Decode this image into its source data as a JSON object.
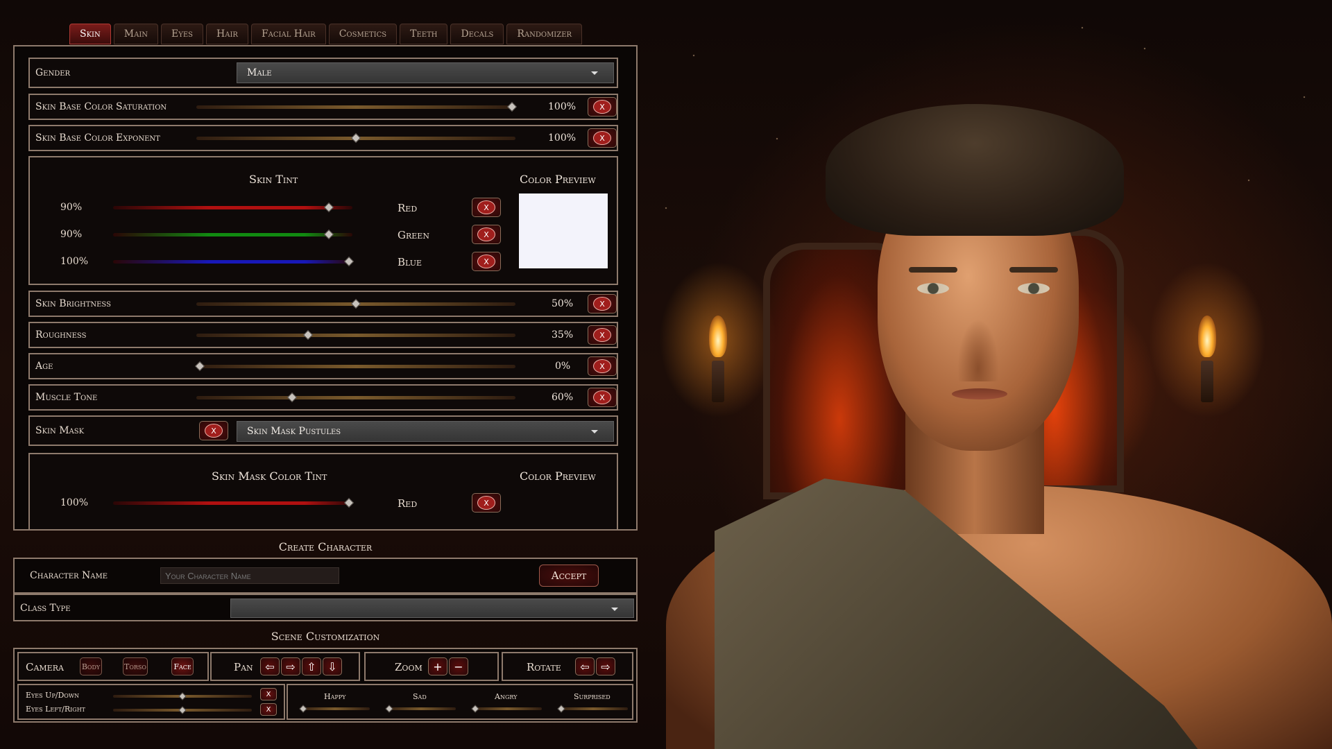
{
  "tabs": [
    {
      "label": "Skin",
      "active": true
    },
    {
      "label": "Main"
    },
    {
      "label": "Eyes"
    },
    {
      "label": "Hair"
    },
    {
      "label": "Facial Hair"
    },
    {
      "label": "Cosmetics"
    },
    {
      "label": "Teeth"
    },
    {
      "label": "Decals"
    },
    {
      "label": "Randomizer"
    }
  ],
  "gender": {
    "label": "Gender",
    "value": "Male"
  },
  "sliders_top": [
    {
      "label": "Skin Base Color Saturation",
      "value": "100%",
      "level": 1.0
    },
    {
      "label": "Skin Base Color Exponent",
      "value": "100%",
      "level": 0.5
    }
  ],
  "skin_tint": {
    "title": "Skin Tint",
    "preview_title": "Color Preview",
    "preview_color": "#f3f3fb",
    "channels": [
      {
        "pct": "90%",
        "name": "Red",
        "color": "#b01010",
        "level": 0.9
      },
      {
        "pct": "90%",
        "name": "Green",
        "color": "#118a11",
        "level": 0.9
      },
      {
        "pct": "100%",
        "name": "Blue",
        "color": "#1818b8",
        "level": 1.0
      }
    ]
  },
  "sliders_mid": [
    {
      "label": "Skin Brightness",
      "value": "50%",
      "level": 0.5
    },
    {
      "label": "Roughness",
      "value": "35%",
      "level": 0.35
    },
    {
      "label": "Age",
      "value": "0%",
      "level": 0.0
    },
    {
      "label": "Muscle Tone",
      "value": "60%",
      "level": 0.3
    }
  ],
  "skin_mask": {
    "label": "Skin Mask",
    "value": "Skin Mask Pustules"
  },
  "mask_tint": {
    "title": "Skin Mask Color Tint",
    "preview_title": "Color Preview",
    "channels": [
      {
        "pct": "100%",
        "name": "Red",
        "color": "#b01010",
        "level": 1.0
      }
    ]
  },
  "x_glyph": "X",
  "create": {
    "title": "Create Character",
    "name_label": "Character Name",
    "name_placeholder": "Your Character Name",
    "accept_label": "Accept",
    "class_label": "Class Type",
    "class_value": ""
  },
  "scene": {
    "title": "Scene Customization",
    "camera_label": "Camera",
    "camera_buttons": [
      "Body",
      "Torso",
      "Face"
    ],
    "pan_label": "Pan",
    "pan_arrows": [
      "⇦",
      "⇨",
      "⇧",
      "⇩"
    ],
    "zoom_label": "Zoom",
    "zoom_buttons": [
      "+",
      "−"
    ],
    "rotate_label": "Rotate",
    "rotate_arrows": [
      "⇦",
      "⇨"
    ],
    "eyes": [
      {
        "label": "Eyes Up/Down",
        "level": 0.5
      },
      {
        "label": "Eyes Left/Right",
        "level": 0.5
      }
    ],
    "expressions": [
      {
        "label": "Happy",
        "level": 0.0
      },
      {
        "label": "Sad",
        "level": 0.0
      },
      {
        "label": "Angry",
        "level": 0.0
      },
      {
        "label": "Surprised",
        "level": 0.0
      }
    ]
  }
}
